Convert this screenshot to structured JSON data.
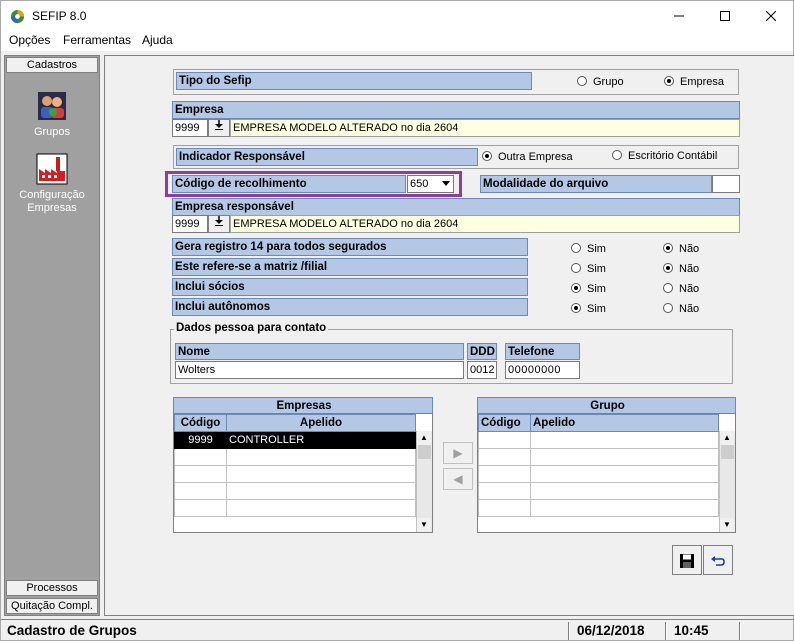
{
  "window": {
    "title": "SEFIP 8.0"
  },
  "menu": {
    "opcoes": "Opções",
    "ferramentas": "Ferramentas",
    "ajuda": "Ajuda"
  },
  "sidebar": {
    "header": "Cadastros",
    "items": [
      {
        "label": "Grupos",
        "icon": "groups-icon"
      },
      {
        "label": "Configuração\nEmpresas",
        "icon": "factory-icon"
      }
    ],
    "footer_items": [
      "Processos",
      "Quitação Compl."
    ]
  },
  "form": {
    "tipo_sefip": {
      "label": "Tipo do Sefip",
      "options": [
        "Grupo",
        "Empresa"
      ],
      "selected": "Empresa"
    },
    "empresa": {
      "label": "Empresa",
      "code": "9999",
      "name": "EMPRESA MODELO ALTERADO no dia 2604"
    },
    "indicador": {
      "label": "Indicador Responsável",
      "options": [
        "Outra Empresa",
        "Escritório Contábil"
      ],
      "selected": "Outra Empresa"
    },
    "codigo_recolhimento": {
      "label": "Código de recolhimento",
      "value": "650"
    },
    "modalidade": {
      "label": "Modalidade do arquivo",
      "value": ""
    },
    "empresa_responsavel": {
      "label": "Empresa responsável",
      "code": "9999",
      "name": "EMPRESA MODELO ALTERADO no dia 2604"
    },
    "yesno": [
      {
        "label": "Gera registro 14 para todos segurados",
        "selected": "Não"
      },
      {
        "label": "Este refere-se a matriz /filial",
        "selected": "Não"
      },
      {
        "label": "Inclui sócios",
        "selected": "Sim"
      },
      {
        "label": "Inclui autônomos",
        "selected": "Sim"
      }
    ],
    "yes_label": "Sim",
    "no_label": "Não",
    "contato": {
      "group_label": "Dados pessoa para contato",
      "nome_label": "Nome",
      "nome_value": "Wolters",
      "ddd_label": "DDD",
      "ddd_value": "0012",
      "telefone_label": "Telefone",
      "telefone_value": "00000000"
    }
  },
  "empresas_grid": {
    "title": "Empresas",
    "columns": [
      "Código",
      "Apelido"
    ],
    "rows": [
      {
        "codigo": "9999",
        "apelido": "CONTROLLER"
      }
    ]
  },
  "grupo_grid": {
    "title": "Grupo",
    "columns": [
      "Código",
      "Apelido"
    ],
    "rows": []
  },
  "buttons": {
    "move_right": "▶",
    "move_left": "◀",
    "save": "save-icon",
    "undo": "undo-icon"
  },
  "status": {
    "screen": "Cadastro de Grupos",
    "date": "06/12/2018",
    "time": "10:45"
  },
  "colors": {
    "header_bg": "#b4c8e6",
    "highlight_border": "#8a3ea0",
    "yellow_field": "#ffffe1"
  }
}
